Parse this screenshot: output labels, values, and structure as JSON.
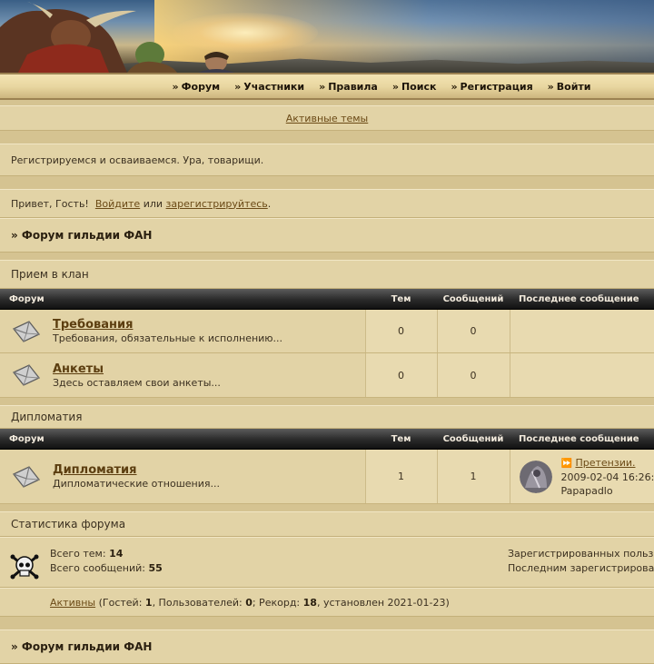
{
  "nav": {
    "items": [
      {
        "label": "Форум"
      },
      {
        "label": "Участники"
      },
      {
        "label": "Правила"
      },
      {
        "label": "Поиск"
      },
      {
        "label": "Регистрация"
      },
      {
        "label": "Войти"
      }
    ]
  },
  "active_topics": "Активные темы",
  "announcement": "Регистрируемся и осваиваемся. Ура, товарищи.",
  "greeting": {
    "prefix": "Привет, Гость!",
    "login": "Войдите",
    "or": "или",
    "register": "зарегистрируйтесь",
    "suffix": "."
  },
  "breadcrumb": "» Форум гильдии ФАН",
  "columns": {
    "forum": "Форум",
    "topics": "Тем",
    "posts": "Сообщений",
    "last_post": "Последнее сообщение"
  },
  "categories": [
    {
      "title": "Прием в клан",
      "forums": [
        {
          "name": "Требования",
          "desc": "Требования, обязательные к исполнению...",
          "topics": "0",
          "posts": "0"
        },
        {
          "name": "Анкеты",
          "desc": "Здесь оставляем свои анкеты...",
          "topics": "0",
          "posts": "0"
        }
      ]
    },
    {
      "title": "Дипломатия",
      "forums": [
        {
          "name": "Дипломатия",
          "desc": "Дипломатические отношения...",
          "topics": "1",
          "posts": "1",
          "last_post": {
            "topic": "Претензии.",
            "date": "2009-02-04 16:26:",
            "author": "Papapadlo"
          }
        }
      ]
    }
  ],
  "stats": {
    "title": "Статистика форума",
    "total_topics_label": "Всего тем:",
    "total_topics": "14",
    "total_posts_label": "Всего сообщений:",
    "total_posts": "55",
    "registered_label": "Зарегистрированных польз",
    "last_registered_label": "Последним зарегистрирова",
    "active_link": "Активны",
    "guests_label": "(Гостей:",
    "guests": "1",
    "users_label": ", Пользователей:",
    "users": "0",
    "record_label": "; Рекорд:",
    "record": "18",
    "record_date": ", установлен 2021-01-23)"
  },
  "footer_breadcrumb": "» Форум гильдии ФАН"
}
